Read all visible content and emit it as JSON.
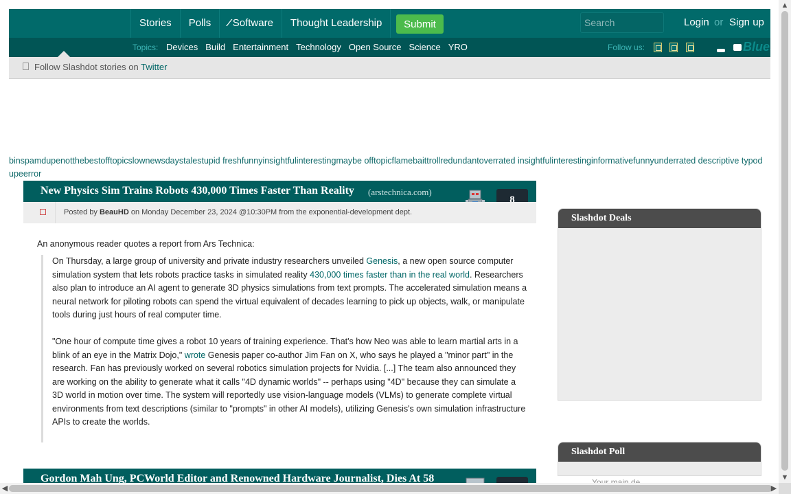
{
  "nav": {
    "items": [
      "Stories",
      "Polls",
      "Software",
      "Thought Leadership"
    ],
    "submit_label": "Submit",
    "search_placeholder": "Search",
    "login_label": "Login",
    "or_label": "or",
    "signup_label": "Sign up"
  },
  "topics": {
    "label": "Topics:",
    "items": [
      "Devices",
      "Build",
      "Entertainment",
      "Technology",
      "Open Source",
      "Science",
      "YRO"
    ],
    "follow_label": "Follow us:",
    "bluesky_label": "Blues"
  },
  "follow_bar": {
    "text": "Follow Slashdot stories on",
    "link": "Twitter"
  },
  "filters": "binspamdupenotthebestofftopicslownewsdaystalestupid freshfunnyinsightfulinterestingmaybe offtopicflamebaittrollredundantoverrated insightfulinterestinginformativefunnyunderrated descriptive typodupeerror",
  "story1": {
    "title": "New Physics Sim Trains Robots 430,000 Times Faster Than Reality",
    "source": "(arstechnica.com)",
    "comments": "8",
    "posted_prefix": "Posted by",
    "author": "BeauHD",
    "posted_date": "on Monday December 23, 2024 @10:30PM",
    "dept": "from the exponential-development dept.",
    "intro": "An anonymous reader quotes a report from Ars Technica:",
    "p1_a": "On Thursday, a large group of university and private industry researchers unveiled ",
    "p1_link1": "Genesis",
    "p1_b": ", a new open source computer simulation system that lets robots practice tasks in simulated reality ",
    "p1_link2": "430,000 times faster than in the real world",
    "p1_c": ". Researchers also plan to introduce an AI agent to generate 3D physics simulations from text prompts. The accelerated simulation means a neural network for piloting robots can spend the virtual equivalent of decades learning to pick up objects, walk, or manipulate tools during just hours of real computer time.",
    "p2_a": "\"One hour of compute time gives a robot 10 years of training experience. That's how Neo was able to learn martial arts in a blink of an eye in the Matrix Dojo,\" ",
    "p2_link": "wrote",
    "p2_b": " Genesis paper co-author Jim Fan on X, who says he played a \"minor part\" in the research. Fan has previously worked on several robotics simulation projects for Nvidia. [...] The team also announced they are working on the ability to generate what it calls \"4D dynamic worlds\" -- perhaps using \"4D\" because they can simulate a 3D world in motion over time. The system will reportedly use vision-language models (VLMs) to generate complete virtual environments from text descriptions (similar to \"prompts\" in other AI models), utilizing Genesis's own simulation infrastructure APIs to create the worlds."
  },
  "story2": {
    "title": "Gordon Mah Ung, PCWorld Editor and Renowned Hardware Journalist, Dies At 58"
  },
  "sidebar": {
    "deals_title": "Slashdot Deals",
    "poll_title": "Slashdot Poll",
    "poll_question": "Your main de..."
  },
  "colors": {
    "header": "#016a6a",
    "topics_bar": "#015555",
    "submit": "#4cbb4c",
    "story_head": "#015e5e",
    "sidebar_head": "#4c4c4c"
  }
}
